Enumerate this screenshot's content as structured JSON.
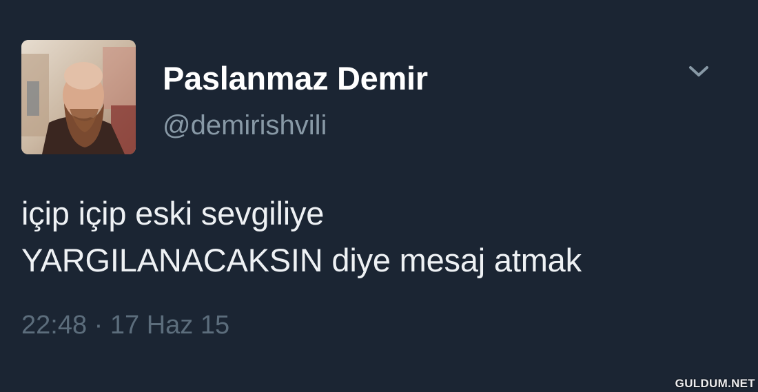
{
  "tweet": {
    "author": {
      "display_name": "Paslanmaz Demir",
      "handle": "@demirishvili"
    },
    "text_lines": [
      "içip içip eski sevgiliye",
      "YARGILANACAKSIN diye mesaj atmak"
    ],
    "timestamp": "22:48 · 17 Haz 15",
    "menu_icon": "chevron-down-icon"
  },
  "watermark": "GULDUM.NET",
  "colors": {
    "background": "#1b2533",
    "display_name": "#ffffff",
    "handle": "#8899a6",
    "text": "#eef1f4",
    "timestamp": "#5c6d7c"
  }
}
